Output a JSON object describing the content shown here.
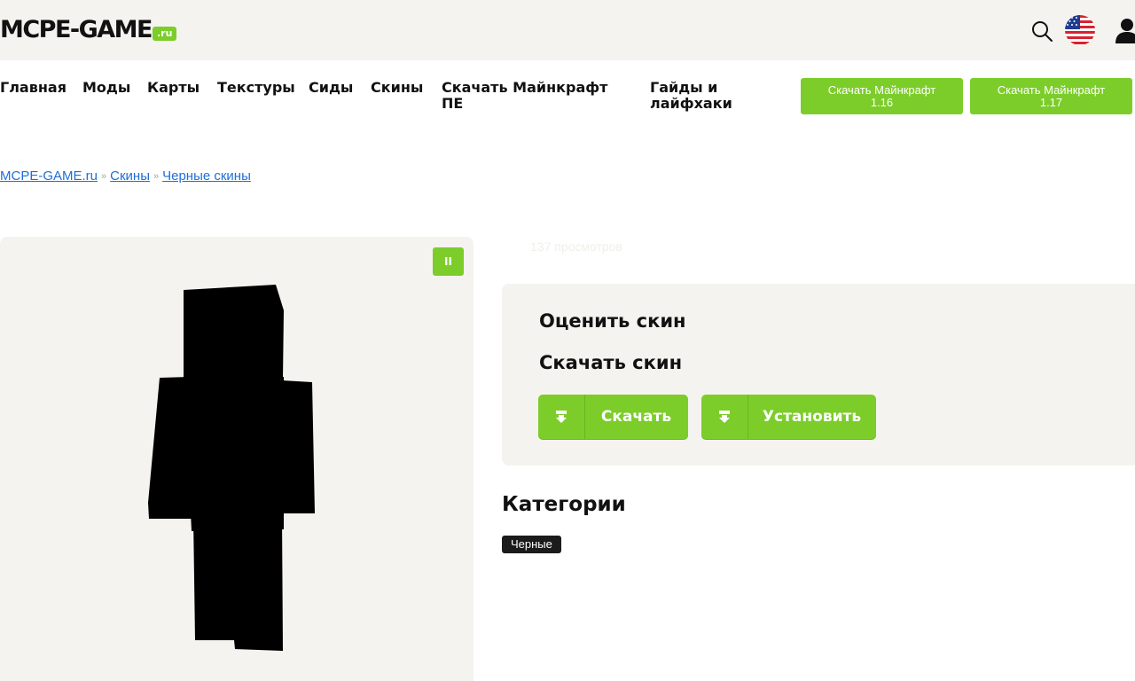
{
  "header": {
    "logo_text": "MCPE-GAME",
    "logo_suffix": ".ru"
  },
  "nav": {
    "items": [
      {
        "label": "Главная"
      },
      {
        "label": "Моды"
      },
      {
        "label": "Карты"
      },
      {
        "label": "Текстуры"
      },
      {
        "label": "Сиды"
      },
      {
        "label": "Скины"
      },
      {
        "label_line1": "Скачать Майнкрафт",
        "label_line2": "ПЕ"
      },
      {
        "label_line1": "Гайды и",
        "label_line2": "лайфхаки"
      }
    ],
    "buttons": [
      {
        "line1": "Скачать Майнкрафт",
        "line2": "1.16"
      },
      {
        "line1": "Скачать Майнкрафт",
        "line2": "1.17"
      }
    ]
  },
  "breadcrumb": {
    "home": "MCPE-GAME.ru",
    "section": "Скины",
    "current": "Черные скины",
    "separator": "»"
  },
  "preview": {
    "pause_label": "II"
  },
  "skin": {
    "views": "137 просмотров",
    "rate_heading": "Оценить скин",
    "download_heading": "Скачать скин",
    "download_button": "Скачать",
    "install_button": "Установить"
  },
  "categories": {
    "title": "Категории",
    "tags": [
      "Черные"
    ]
  },
  "colors": {
    "accent": "#7ccd2a",
    "panel_bg": "#f5f3ef",
    "link": "#1e6fd9",
    "tag_bg": "#1b1b1b"
  },
  "icons": {
    "search": "search-icon",
    "language": "us-flag-icon",
    "account": "user-icon",
    "download": "download-icon"
  }
}
